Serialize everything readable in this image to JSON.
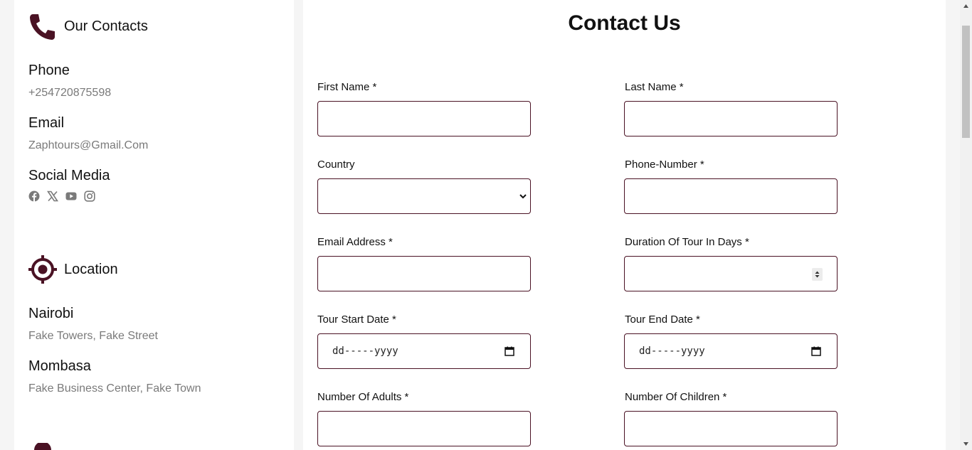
{
  "contacts": {
    "heading": "Our Contacts",
    "heading_icon": "phone-icon",
    "phone_label": "Phone",
    "phone_value": "+254720875598",
    "email_label": "Email",
    "email_value": "Zaphtours@Gmail.Com",
    "social_label": "Social Media",
    "social_icons": [
      "facebook-icon",
      "x-twitter-icon",
      "youtube-icon",
      "instagram-icon"
    ]
  },
  "location": {
    "heading": "Location",
    "heading_icon": "location-target-icon",
    "offices": [
      {
        "city": "Nairobi",
        "address": "Fake Towers, Fake Street"
      },
      {
        "city": "Mombasa",
        "address": "Fake Business Center, Fake Town"
      }
    ]
  },
  "form": {
    "title": "Contact Us",
    "first_name_label": "First Name *",
    "last_name_label": "Last Name *",
    "country_label": "Country",
    "phone_label": "Phone-Number *",
    "email_label": "Email Address *",
    "duration_label": "Duration Of Tour In Days *",
    "start_date_label": "Tour Start Date *",
    "start_date_placeholder": "dd-----yyyy",
    "end_date_label": "Tour End Date *",
    "end_date_placeholder": "dd-----yyyy",
    "adults_label": "Number Of Adults *",
    "children_label": "Number Of Children *"
  },
  "colors": {
    "accent": "#4a1224",
    "muted_text": "#7a7a7a",
    "social_icon": "#7a7a7a"
  }
}
